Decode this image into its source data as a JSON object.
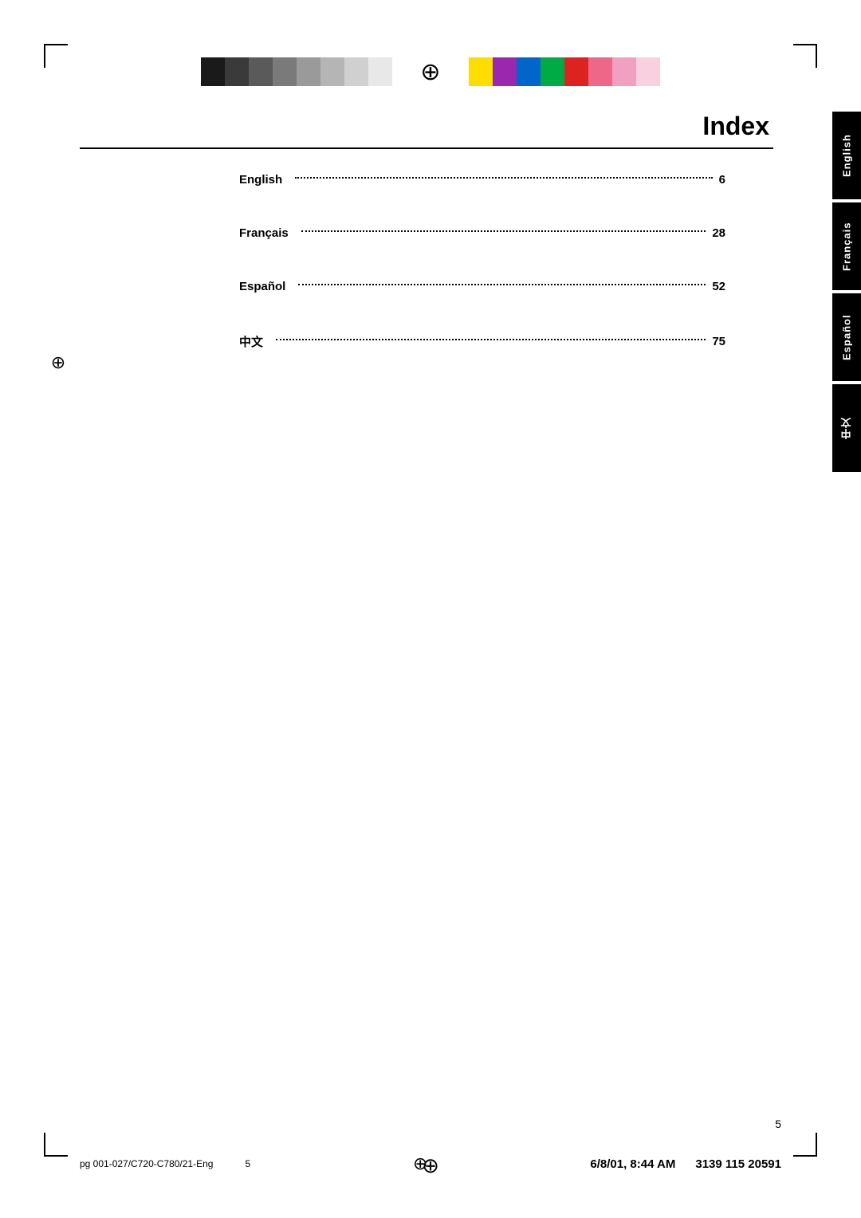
{
  "page": {
    "title": "Index",
    "number": "5",
    "background": "#ffffff"
  },
  "colorStrip": {
    "leftColors": [
      "#1a1a1a",
      "#3a3a3a",
      "#5a5a5a",
      "#7a7a7a",
      "#9a9a9a",
      "#b5b5b5",
      "#d0d0d0",
      "#e8e8e8"
    ],
    "rightColors": [
      "#ffdd00",
      "#9b27af",
      "#0066cc",
      "#00aa44",
      "#dd2222",
      "#ee6688",
      "#f0a0c0",
      "#f8d0e0"
    ]
  },
  "indexEntries": [
    {
      "label": "English",
      "dots": "------------------------------------------------",
      "page": "6"
    },
    {
      "label": "Français",
      "dots": "--------------------------------------------",
      "page": "28"
    },
    {
      "label": "Español",
      "dots": "--------------------------------------------",
      "page": "52"
    },
    {
      "label": "中文",
      "dots": "------------------------------------------------",
      "page": "75"
    }
  ],
  "sideTabs": [
    {
      "label": "English"
    },
    {
      "label": "Français"
    },
    {
      "label": "Español"
    },
    {
      "label": "中文"
    }
  ],
  "footer": {
    "left": "pg 001-027/C720-C780/21-Eng",
    "center": "5",
    "right": "3139 115 20591",
    "timestamp": "6/8/01, 8:44 AM"
  }
}
